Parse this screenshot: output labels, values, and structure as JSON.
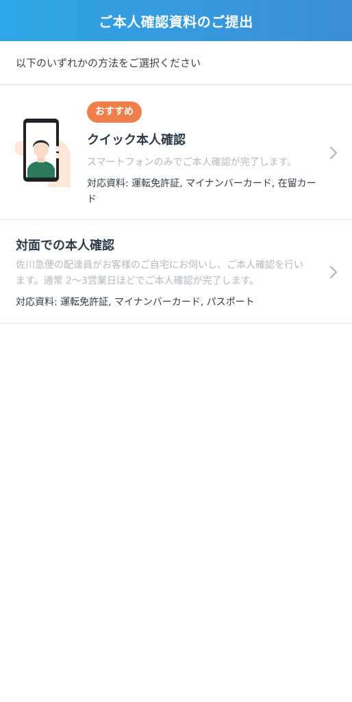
{
  "header": {
    "title": "ご本人確認資料のご提出"
  },
  "intro": {
    "text": "以下のいずれかの方法をご選択ください"
  },
  "options": [
    {
      "badge": "おすすめ",
      "title": "クイック本人確認",
      "description": "スマートフォンのみでご本人確認が完了します。",
      "documents": "対応資料: 運転免許証, マイナンバーカード, 在留カード",
      "icon": "phone-selfie-illustration"
    },
    {
      "title": "対面での本人確認",
      "description": "佐川急便の配達員がお客様のご自宅にお伺いし、ご本人確認を行います。通常 2～3営業日ほどでご本人確認が完了します。",
      "documents": "対応資料: 運転免許証, マイナンバーカード, パスポート"
    }
  ],
  "colors": {
    "header_gradient_start": "#2da6e6",
    "header_gradient_end": "#3d8ed6",
    "badge": "#ef7f4a",
    "muted_text": "#b3b8bd",
    "divider": "#e3e3e3"
  }
}
